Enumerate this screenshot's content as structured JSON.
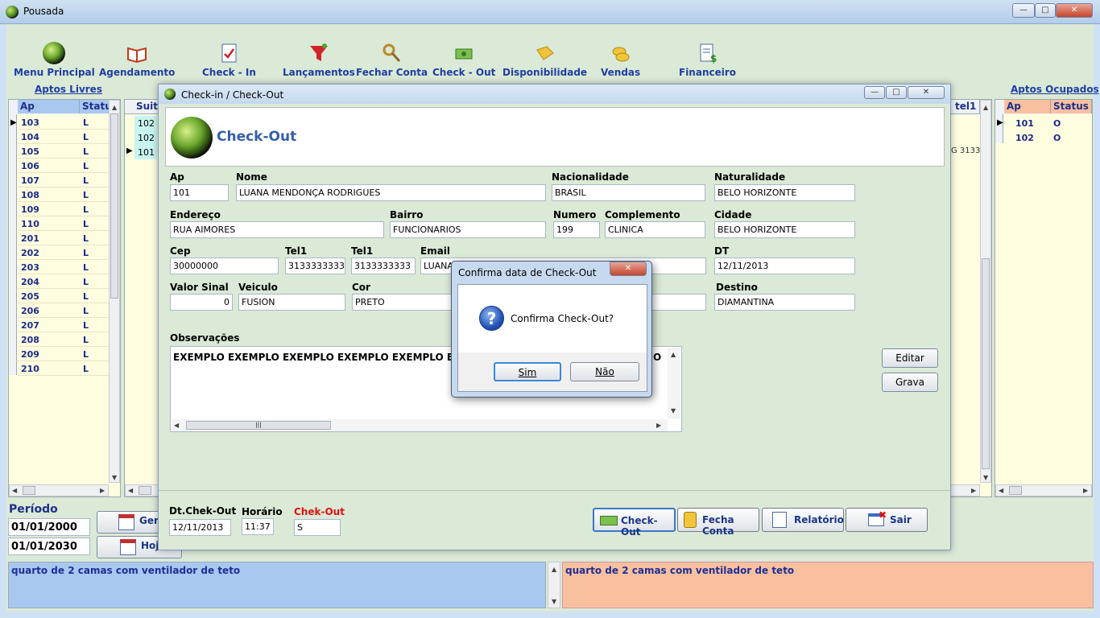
{
  "app": {
    "title": "Pousada"
  },
  "toolbar": [
    {
      "label": "Menu Principal",
      "icon": "globe-icon"
    },
    {
      "label": "Agendamento",
      "icon": "book-icon"
    },
    {
      "label": "Check - In",
      "icon": "checklist-icon"
    },
    {
      "label": "Lançamentos",
      "icon": "funnel-icon"
    },
    {
      "label": "Fechar Conta",
      "icon": "key-icon"
    },
    {
      "label": "Check - Out",
      "icon": "cash-icon"
    },
    {
      "label": "Disponibilidade",
      "icon": "tag-icon"
    },
    {
      "label": "Vendas",
      "icon": "coins-icon"
    },
    {
      "label": "Financeiro",
      "icon": "money-report-icon"
    }
  ],
  "left_panel": {
    "link": "Aptos Livres",
    "headers": [
      "Ap",
      "Status"
    ],
    "rows": [
      {
        "ap": "103",
        "status": "L"
      },
      {
        "ap": "104",
        "status": "L"
      },
      {
        "ap": "105",
        "status": "L"
      },
      {
        "ap": "106",
        "status": "L"
      },
      {
        "ap": "107",
        "status": "L"
      },
      {
        "ap": "108",
        "status": "L"
      },
      {
        "ap": "109",
        "status": "L"
      },
      {
        "ap": "110",
        "status": "L"
      },
      {
        "ap": "201",
        "status": "L"
      },
      {
        "ap": "202",
        "status": "L"
      },
      {
        "ap": "203",
        "status": "L"
      },
      {
        "ap": "204",
        "status": "L"
      },
      {
        "ap": "205",
        "status": "L"
      },
      {
        "ap": "206",
        "status": "L"
      },
      {
        "ap": "207",
        "status": "L"
      },
      {
        "ap": "208",
        "status": "L"
      },
      {
        "ap": "209",
        "status": "L"
      },
      {
        "ap": "210",
        "status": "L"
      }
    ]
  },
  "middle_grid": {
    "header": "Suite",
    "rows": [
      "102",
      "102",
      "101"
    ],
    "right_header": "tel1",
    "right_cell": "G 3133"
  },
  "right_panel": {
    "link": "Aptos Ocupados",
    "headers": [
      "Ap",
      "Status"
    ],
    "rows": [
      {
        "ap": "101",
        "status": "O"
      },
      {
        "ap": "102",
        "status": "O"
      }
    ]
  },
  "periodo": {
    "label": "Período",
    "from": "01/01/2000",
    "to": "01/01/2030",
    "btn_gera": "Gera",
    "btn_hoje": "Hoje"
  },
  "child": {
    "title": "Check-in / Check-Out",
    "heading": "Check-Out",
    "fields": {
      "ap": {
        "label": "Ap",
        "value": "101"
      },
      "nome": {
        "label": "Nome",
        "value": "LUANA MENDONÇA RODRIGUES"
      },
      "nacionalidade": {
        "label": "Nacionalidade",
        "value": "BRASIL"
      },
      "naturalidade": {
        "label": "Naturalidade",
        "value": "BELO HORIZONTE"
      },
      "endereco": {
        "label": "Endereço",
        "value": "RUA AIMORES"
      },
      "bairro": {
        "label": "Bairro",
        "value": "FUNCIONARIOS"
      },
      "numero": {
        "label": "Numero",
        "value": "199"
      },
      "complemento": {
        "label": "Complemento",
        "value": "CLINICA"
      },
      "cidade": {
        "label": "Cidade",
        "value": "BELO HORIZONTE"
      },
      "cep": {
        "label": "Cep",
        "value": "30000000"
      },
      "tel1a": {
        "label": "Tel1",
        "value": "3133333333"
      },
      "tel1b": {
        "label": "Tel1",
        "value": "3133333333"
      },
      "email": {
        "label": "Email",
        "value": "LUANA"
      },
      "dt": {
        "label": "DT",
        "value": "12/11/2013"
      },
      "valor_sinal": {
        "label": "Valor Sinal",
        "value": "0"
      },
      "veiculo": {
        "label": "Veiculo",
        "value": "FUSION"
      },
      "cor": {
        "label": "Cor",
        "value": "PRETO"
      },
      "destino": {
        "label": "Destino",
        "value": "DIAMANTINA"
      }
    },
    "observacoes": {
      "label": "Observações",
      "value": "EXEMPLO EXEMPLO EXEMPLO EXEMPLO EXEMPLO EXEMP"
    },
    "obs_tail": "O",
    "btn_editar": "Editar",
    "btn_grava": "Grava",
    "dt_checkout": {
      "label": "Dt.Chek-Out",
      "value": "12/11/2013"
    },
    "horario": {
      "label": "Horário",
      "value": "11:37"
    },
    "chek_out": {
      "label": "Chek-Out",
      "value": "S"
    },
    "buttons": {
      "checkout": "Check-Out",
      "fecha_conta": "Fecha Conta",
      "relatorio": "Relatório",
      "sair": "Sair"
    }
  },
  "dialog": {
    "title": "Confirma data de Check-Out",
    "message": "Confirma Check-Out?",
    "yes": "Sim",
    "no": "Não"
  },
  "memo_left": "quarto de 2 camas com ventilador de teto",
  "memo_right": "quarto de 2 camas com ventilador de teto",
  "colors": {
    "free_header": "#a8c8ef",
    "occupied_header": "#f9c0a0",
    "link": "#1f3fa0",
    "heading": "#3560a8",
    "alert": "#e01010"
  }
}
